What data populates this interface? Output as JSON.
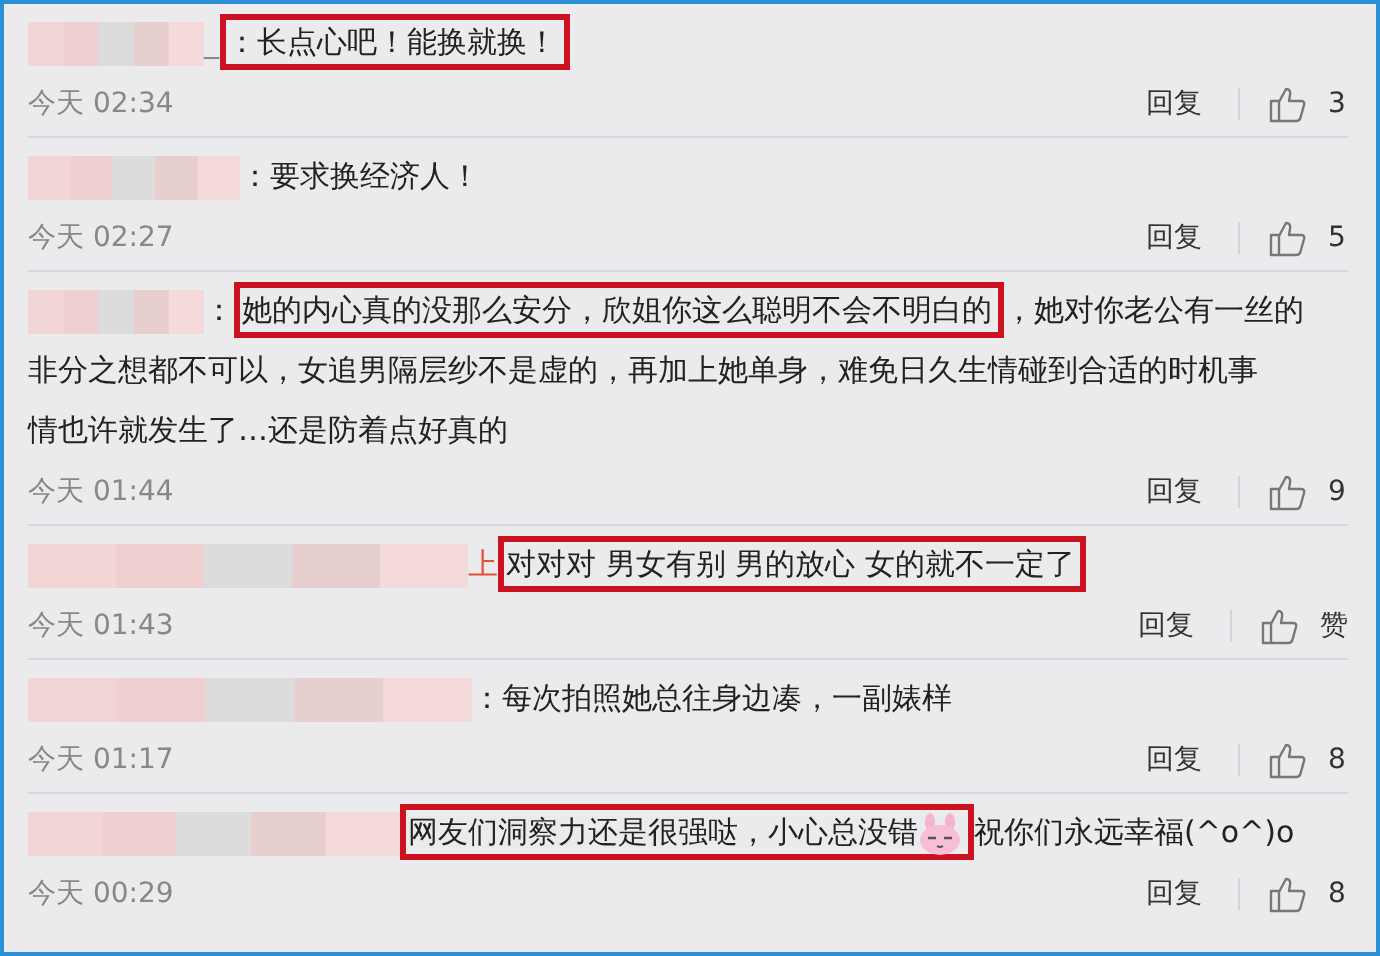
{
  "comments": [
    {
      "name_fragment": "_",
      "lines": [
        [
          {
            "highlighted": true,
            "parts": [
              {
                "kind": "text",
                "text": "：长点心吧！能换就换！"
              }
            ]
          }
        ]
      ],
      "time": "今天 02:34",
      "reply": "回复",
      "likes": "3"
    },
    {
      "lines": [
        [
          {
            "highlighted": false,
            "parts": [
              {
                "kind": "text",
                "text": "：要求换经济人！"
              }
            ]
          }
        ]
      ],
      "time": "今天 02:27",
      "reply": "回复",
      "likes": "5"
    },
    {
      "lines": [
        [
          {
            "highlighted": false,
            "parts": [
              {
                "kind": "text",
                "text": "："
              }
            ]
          },
          {
            "highlighted": true,
            "parts": [
              {
                "kind": "text",
                "text": "她的内心真的没那么安分，欣姐你这么聪明不会不明白的"
              }
            ]
          },
          {
            "highlighted": false,
            "parts": [
              {
                "kind": "text",
                "text": "，她对你老公有一丝的"
              }
            ]
          }
        ],
        [
          {
            "highlighted": false,
            "parts": [
              {
                "kind": "text",
                "text": "非分之想都不可以，女追男隔层纱不是虚的，再加上她单身，难免日久生情碰到合适的时机事情也许就发生了…还是防着点好真的"
              }
            ]
          }
        ]
      ],
      "time": "今天 01:44",
      "reply": "回复",
      "likes": "9"
    },
    {
      "name_fragment": "上",
      "lines": [
        [
          {
            "highlighted": true,
            "parts": [
              {
                "kind": "text",
                "text": "对对对 男女有别 男的放心 女的就不一定了"
              }
            ]
          }
        ]
      ],
      "time": "今天 01:43",
      "reply": "回复",
      "likes": "赞"
    },
    {
      "lines": [
        [
          {
            "highlighted": false,
            "parts": [
              {
                "kind": "text",
                "text": "：每次拍照她总往身边凑，一副婊样"
              }
            ]
          }
        ]
      ],
      "time": "今天 01:17",
      "reply": "回复",
      "likes": "8"
    },
    {
      "lines": [
        [
          {
            "highlighted": true,
            "parts": [
              {
                "kind": "text",
                "text": "网友们洞察力还是很强哒，小心总没错"
              },
              {
                "kind": "emoji"
              }
            ]
          },
          {
            "highlighted": false,
            "parts": [
              {
                "kind": "text",
                "text": "祝你们永远幸福(^o^)o"
              }
            ]
          }
        ]
      ],
      "time": "今天 00:29",
      "reply": "回复",
      "likes": "8"
    }
  ]
}
